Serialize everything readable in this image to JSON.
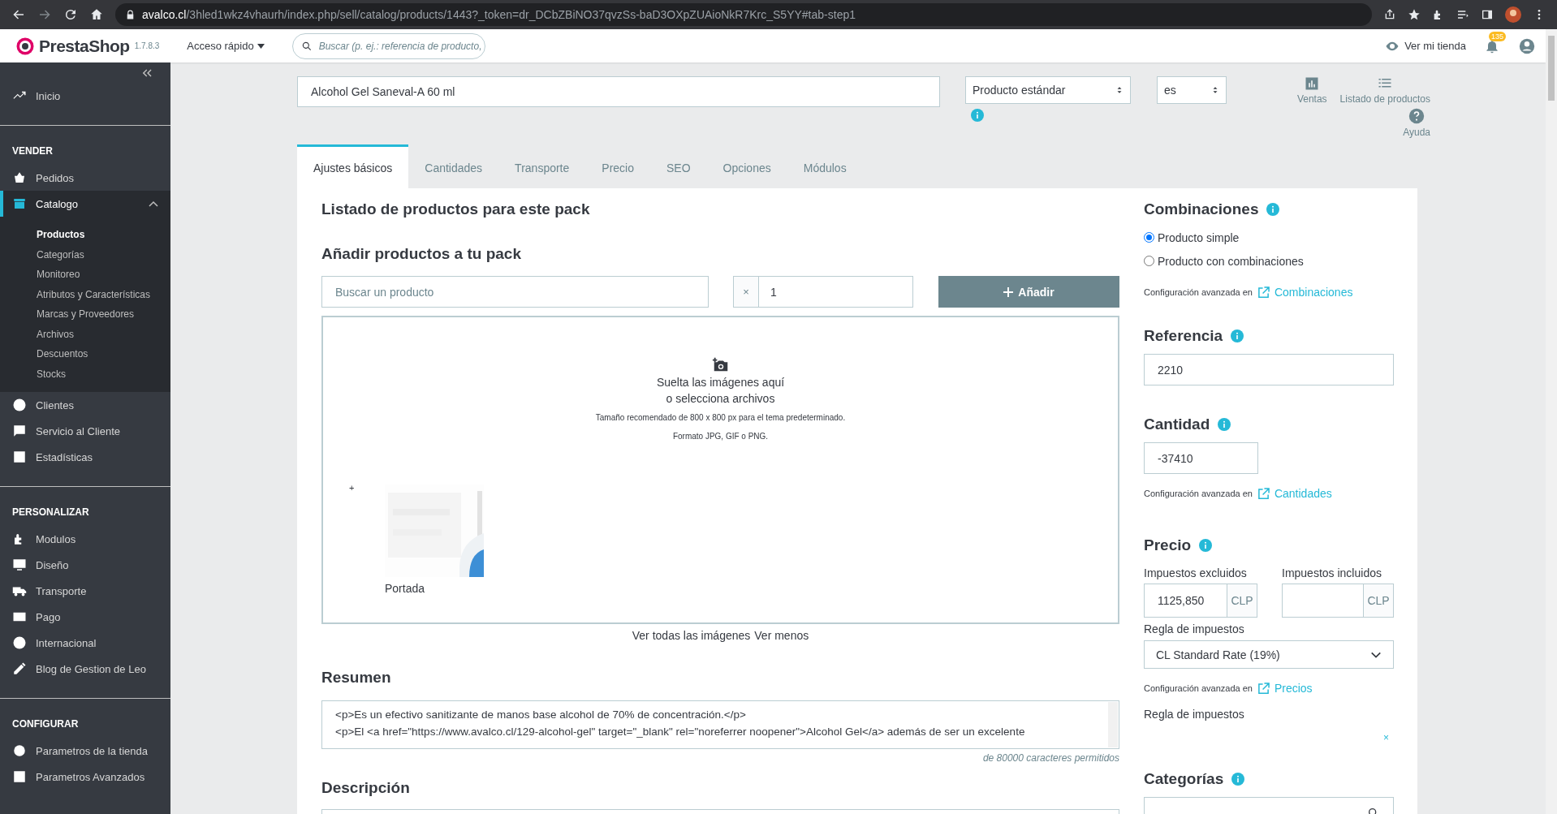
{
  "browser": {
    "url_host": "avalco.cl",
    "url_path": "/3hled1wkz4vhaurh/index.php/sell/catalog/products/1443?_token=dr_DCbZBiNO37qvzSs-baD3OXpZUAioNkR7Krc_S5YY#tab-step1"
  },
  "header": {
    "logo": "PrestaShop",
    "version": "1.7.8.3",
    "quick_access": "Acceso rápido",
    "search": {
      "placeholder": "Buscar (p. ej.: referencia de producto,"
    },
    "view_store": "Ver mi tienda",
    "notifications": "135"
  },
  "sidebar": {
    "sections": [
      {
        "items": [
          {
            "label": "Inicio",
            "selected": false,
            "expanded": false
          }
        ]
      },
      {
        "title": "VENDER",
        "items": [
          {
            "label": "Pedidos",
            "selected": false,
            "expanded": false
          },
          {
            "label": "Catalogo",
            "selected": true,
            "expanded": true,
            "children": [
              {
                "label": "Productos",
                "selected": true
              },
              {
                "label": "Categorías",
                "selected": false
              },
              {
                "label": "Monitoreo",
                "selected": false
              },
              {
                "label": "Atributos y Características",
                "selected": false
              },
              {
                "label": "Marcas y Proveedores",
                "selected": false
              },
              {
                "label": "Archivos",
                "selected": false
              },
              {
                "label": "Descuentos",
                "selected": false
              },
              {
                "label": "Stocks",
                "selected": false
              }
            ]
          },
          {
            "label": "Clientes",
            "selected": false,
            "expanded": false
          },
          {
            "label": "Servicio al Cliente",
            "selected": false,
            "expanded": false
          },
          {
            "label": "Estadísticas",
            "selected": false,
            "expanded": false
          }
        ]
      },
      {
        "title": "PERSONALIZAR",
        "items": [
          {
            "label": "Modulos",
            "selected": false,
            "expanded": false
          },
          {
            "label": "Diseño",
            "selected": false,
            "expanded": false
          },
          {
            "label": "Transporte",
            "selected": false,
            "expanded": false
          },
          {
            "label": "Pago",
            "selected": false,
            "expanded": false
          },
          {
            "label": "Internacional",
            "selected": false,
            "expanded": false
          },
          {
            "label": "Blog de Gestion de Leo",
            "selected": false,
            "expanded": false
          }
        ]
      },
      {
        "title": "CONFIGURAR",
        "items": [
          {
            "label": "Parametros de la tienda",
            "selected": false,
            "expanded": false
          },
          {
            "label": "Parametros Avanzados",
            "selected": false,
            "expanded": false
          }
        ]
      }
    ]
  },
  "product": {
    "name": "Alcohol Gel Saneval-A 60 ml",
    "type": "Producto estándar",
    "language": "es"
  },
  "toolbar": [
    {
      "label": "Ventas"
    },
    {
      "label": "Listado de productos"
    },
    {
      "label": "Ayuda"
    }
  ],
  "tabs": [
    {
      "label": "Ajustes básicos",
      "selected": true
    },
    {
      "label": "Cantidades",
      "selected": false
    },
    {
      "label": "Transporte",
      "selected": false
    },
    {
      "label": "Precio",
      "selected": false
    },
    {
      "label": "SEO",
      "selected": false
    },
    {
      "label": "Opciones",
      "selected": false
    },
    {
      "label": "Módulos",
      "selected": false
    }
  ],
  "pack": {
    "title": "Listado de productos para este pack",
    "add_title": "Añadir productos a tu pack",
    "search": {
      "placeholder": "Buscar un producto"
    },
    "quantity_prefix": "×",
    "quantity": "1",
    "add_button": "Añadir"
  },
  "images": {
    "drop_title": "Suelta las imágenes aquí",
    "drop_subtitle": "o selecciona archivos",
    "size_hint": "Tamaño recomendado de 800 x 800 px para el tema predeterminado.",
    "formats": "Formato JPG, GIF o PNG.",
    "add_mark": "+",
    "items": [
      {
        "kind": "picture",
        "caption": "Portada"
      }
    ],
    "links": [
      "Ver todas las imágenes",
      "Ver menos"
    ]
  },
  "summary": {
    "title": "Resumen",
    "lines": [
      "<p>Es un efectivo sanitizante de manos base alcohol de 70% de concentración.</p>",
      "<p>El <a href=\"https://www.avalco.cl/129-alcohol-gel\" target=\"_blank\" rel=\"noreferrer noopener\">Alcohol Gel</a> además de ser un excelente"
    ],
    "counter": "de 80000 caracteres permitidos"
  },
  "description": {
    "title": "Descripción"
  },
  "combinations": {
    "title": "Combinaciones",
    "options": [
      {
        "label": "Producto simple",
        "selected": true
      },
      {
        "label": "Producto con combinaciones",
        "selected": false
      }
    ],
    "advanced": "Configuración avanzada en",
    "link": "Combinaciones"
  },
  "reference": {
    "title": "Referencia",
    "value": "2210"
  },
  "quantity": {
    "title": "Cantidad",
    "value": "-37410",
    "advanced": "Configuración avanzada en",
    "link": "Cantidades"
  },
  "price": {
    "title": "Precio",
    "excluded_label": "Impuestos excluidos",
    "excluded_value": "1125,850",
    "included_label": "Impuestos incluidos",
    "currency": "CLP",
    "currency_included": "CLP",
    "tax_rule_label": "Regla de impuestos",
    "tax_rule": "CL Standard Rate (19%)",
    "advanced": "Configuración avanzada en",
    "link": "Precios",
    "tax_rule_label_2": "Regla de impuestos",
    "remove": "×"
  },
  "categories": {
    "title": "Categorías"
  }
}
